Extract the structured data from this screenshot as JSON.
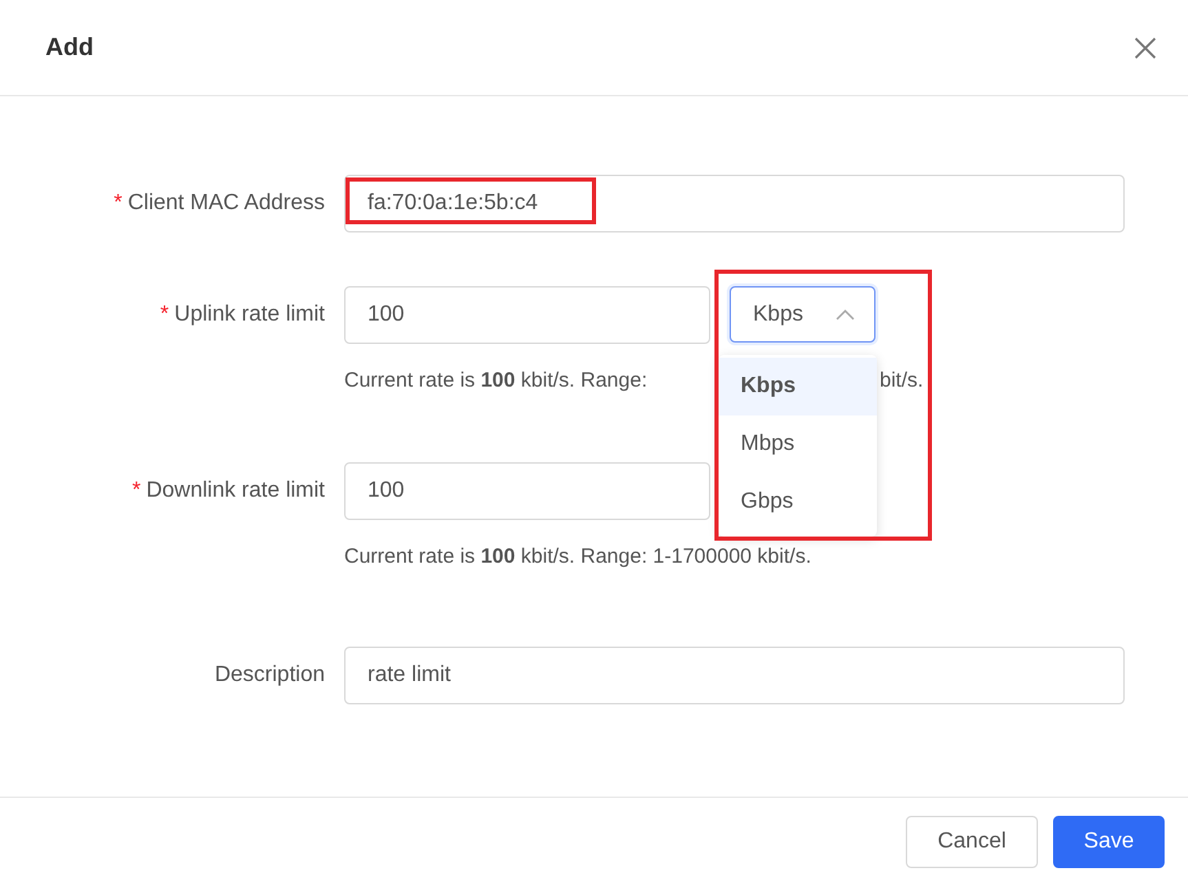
{
  "dialog": {
    "title": "Add"
  },
  "fields": [
    {
      "kind": "text",
      "marker": "*",
      "label": "Client MAC Address",
      "value": "fa:70:0a:1e:5b:c4",
      "highlighted": true
    },
    {
      "kind": "rate",
      "marker": "*",
      "label": "Uplink rate limit",
      "value": "100",
      "unit": {
        "value": "Kbps",
        "open": true,
        "highlighted": true,
        "options": [
          {
            "label": "Kbps",
            "selected": true
          },
          {
            "label": "Mbps",
            "selected": false
          },
          {
            "label": "Gbps",
            "selected": false
          }
        ]
      },
      "hint_parts": [
        "Current rate is **100** kbit/s. Range:",
        "bit/s."
      ]
    },
    {
      "kind": "rate",
      "marker": "*",
      "label": "Downlink rate limit",
      "value": "100",
      "hint_parts": [
        "Current rate is **100** kbit/s. Range: 1-1700000 kbit/s."
      ]
    },
    {
      "kind": "text",
      "label": "Description",
      "value": "rate limit"
    }
  ],
  "buttons": [
    {
      "label": "Cancel",
      "kind": "secondary"
    },
    {
      "label": "Save",
      "kind": "primary"
    }
  ]
}
